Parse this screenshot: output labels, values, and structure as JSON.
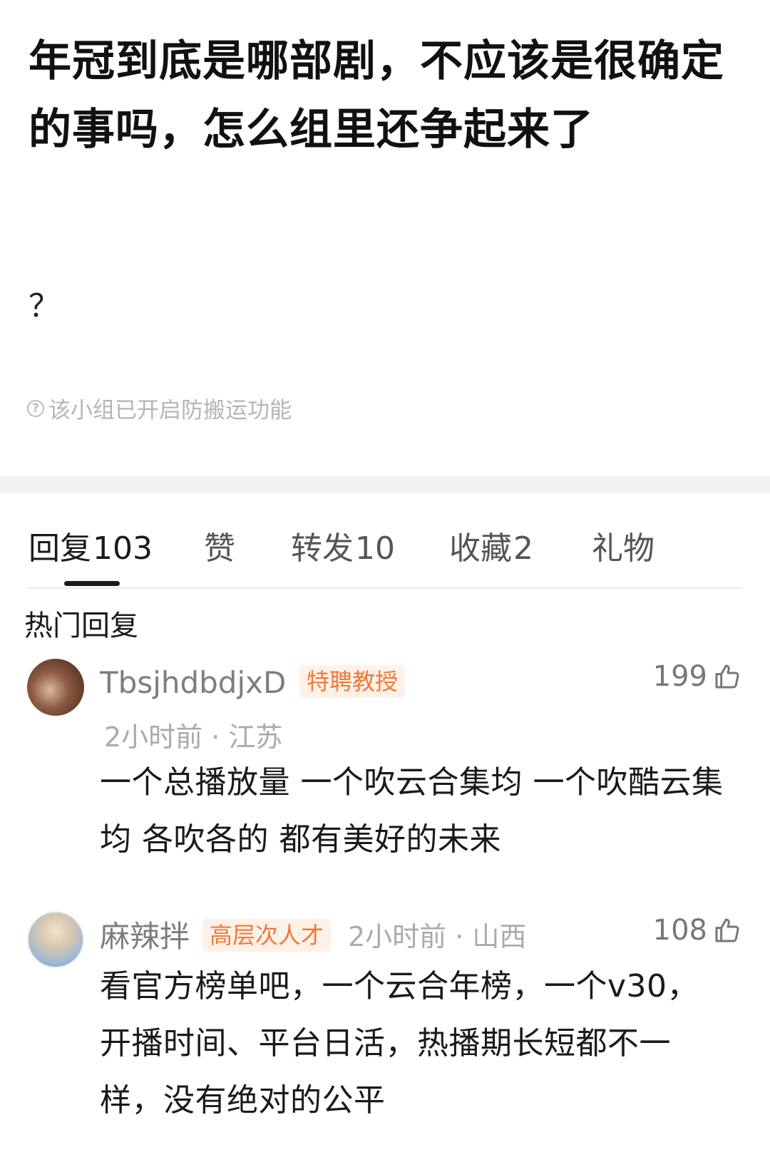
{
  "post": {
    "title": "年冠到底是哪部剧，不应该是很确定的事吗，怎么组里还争起来了",
    "body": "？",
    "notice": "该小组已开启防搬运功能"
  },
  "tabs": [
    {
      "label": "回复",
      "count": "103",
      "active": true
    },
    {
      "label": "赞",
      "count": ""
    },
    {
      "label": "转发",
      "count": "10"
    },
    {
      "label": "收藏",
      "count": "2"
    },
    {
      "label": "礼物",
      "count": ""
    }
  ],
  "section_label": "热门回复",
  "comments": [
    {
      "username": "TbsjhdbdjxD",
      "badge": "特聘教授",
      "meta": "2小时前 · 江苏",
      "likes": "199",
      "text": "一个总播放量 一个吹云合集均 一个吹酷云集均 各吹各的 都有美好的未来"
    },
    {
      "username": "麻辣拌",
      "badge": "高层次人才",
      "meta": "2小时前 · 山西",
      "likes": "108",
      "text": "看官方榜单吧，一个云合年榜，一个v30，开播时间、平台日活，热播期长短都不一样，没有绝对的公平"
    }
  ],
  "icons": {
    "notice": "info-circle-icon",
    "like": "thumbs-up-icon"
  },
  "colors": {
    "badge_text": "#ee7a3a",
    "badge_bg": "#fff1e8",
    "muted": "#aaaaaa"
  }
}
